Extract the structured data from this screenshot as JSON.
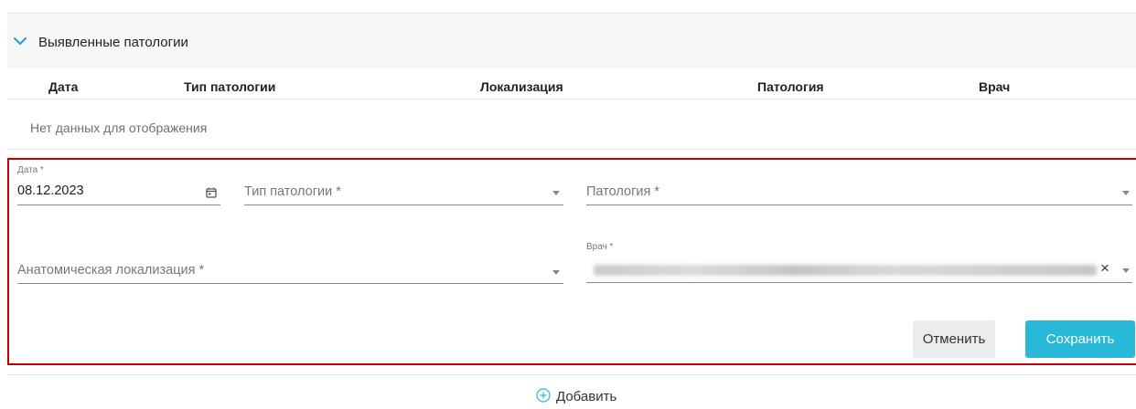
{
  "section": {
    "title": "Выявленные патологии",
    "collapse_icon": "chevron-down-icon"
  },
  "table": {
    "columns": [
      "Дата",
      "Тип патологии",
      "Локализация",
      "Патология",
      "Врач"
    ],
    "empty_text": "Нет данных для отображения"
  },
  "form": {
    "date": {
      "label": "Дата *",
      "value": "08.12.2023",
      "icon": "calendar-icon"
    },
    "pathology_type": {
      "placeholder": "Тип патологии *"
    },
    "pathology": {
      "placeholder": "Патология *"
    },
    "anatomical_localization": {
      "placeholder": "Анатомическая локализация *"
    },
    "doctor": {
      "label": "Врач *",
      "value_hidden": true,
      "clear_symbol": "×"
    },
    "cancel_label": "Отменить",
    "save_label": "Сохранить"
  },
  "add_label": "Добавить",
  "colors": {
    "accent": "#29b8d7",
    "highlight_border": "#c00000",
    "chevron": "#2f9be0"
  }
}
